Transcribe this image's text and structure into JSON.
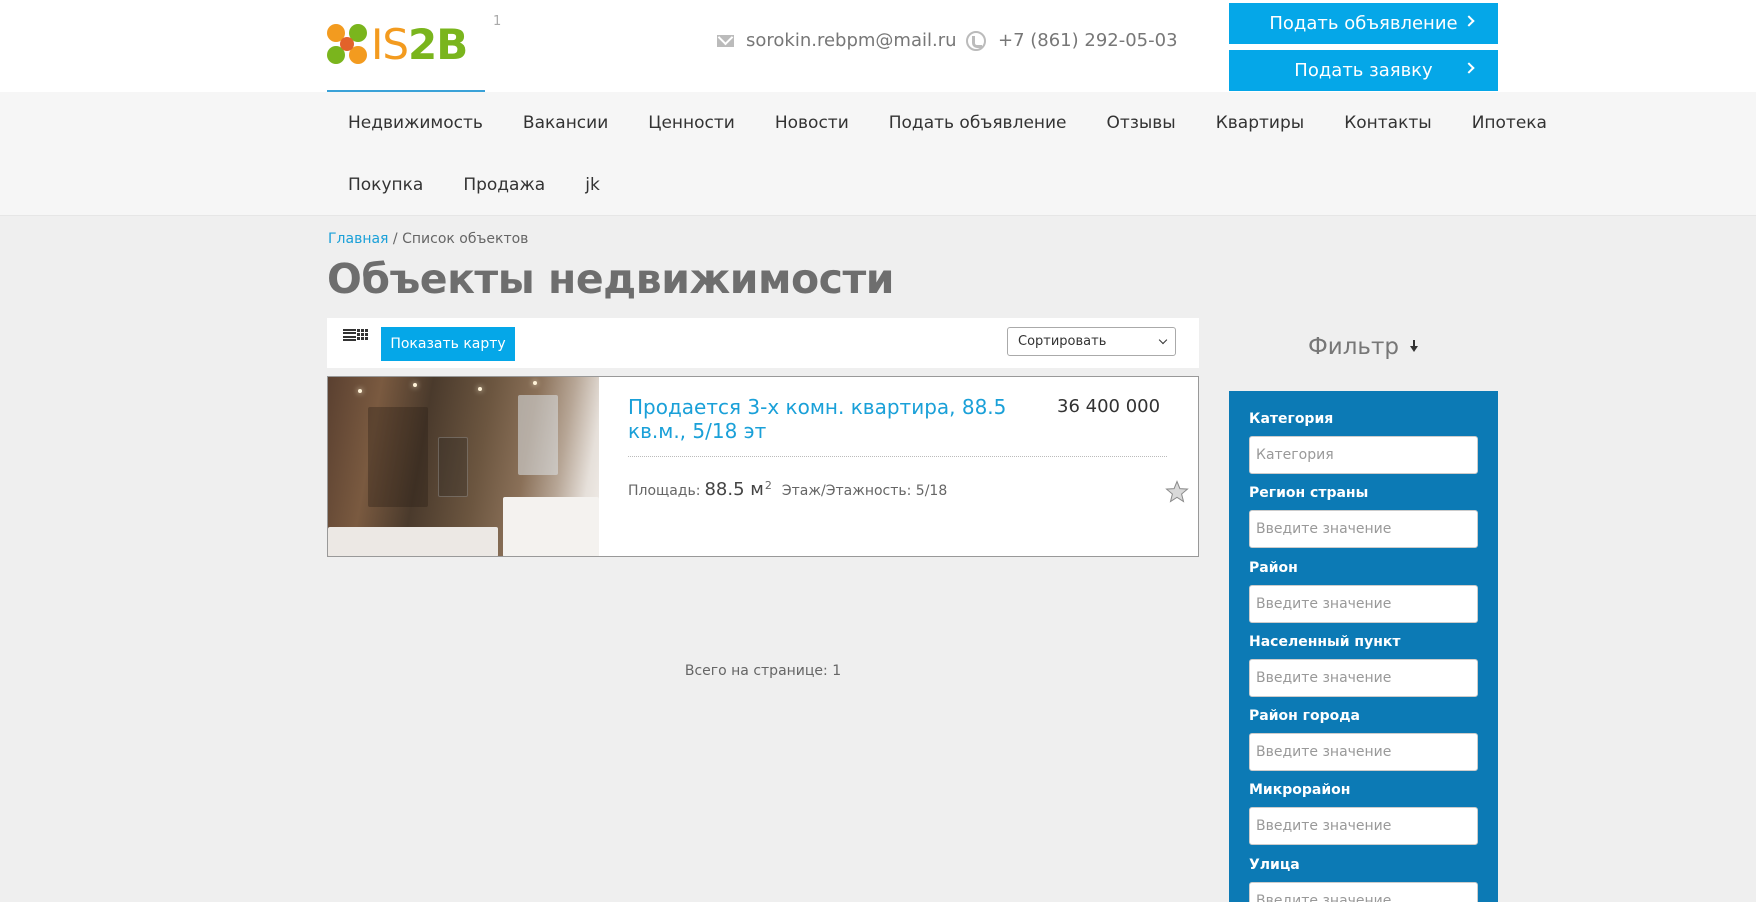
{
  "header": {
    "logo_text_is": "IS",
    "logo_text_2b": "2B",
    "logo_sup": "1",
    "email": "sorokin.rebpm@mail.ru",
    "phone": "+7 (861) 292-05-03",
    "btn_post_ad": "Подать объявление",
    "btn_request": "Подать заявку",
    "icons": {
      "email": "mail-icon",
      "phone": "phone-icon",
      "chevron": "chevron-right-icon"
    }
  },
  "nav": {
    "row1": [
      "Недвижимость",
      "Вакансии",
      "Ценности",
      "Новости",
      "Подать объявление",
      "Отзывы",
      "Квартиры",
      "Контакты",
      "Ипотека"
    ],
    "row2": [
      "Покупка",
      "Продажа",
      "jk"
    ]
  },
  "breadcrumb": {
    "home": "Главная",
    "separator": " / ",
    "current": "Список объектов"
  },
  "page_title": "Объекты недвижимости",
  "toolbar": {
    "show_map": "Показать карту",
    "sort_label": "Сортировать"
  },
  "listing": {
    "title": "Продается 3-х комн. квартира, 88.5 кв.м., 5/18 эт",
    "price": "36 400 000",
    "area_label": "Площадь:",
    "area_value": "88.5 м",
    "area_sup": "2",
    "floor": "Этаж/Этажность: 5/18"
  },
  "total": "Всего на странице: 1",
  "filter": {
    "title": "Фильтр",
    "fields": [
      {
        "label": "Категория",
        "placeholder": "Категория"
      },
      {
        "label": "Регион страны",
        "placeholder": "Введите значение"
      },
      {
        "label": "Район",
        "placeholder": "Введите значение"
      },
      {
        "label": "Населенный пункт",
        "placeholder": "Введите значение"
      },
      {
        "label": "Район города",
        "placeholder": "Введите значение"
      },
      {
        "label": "Микрорайон",
        "placeholder": "Введите значение"
      },
      {
        "label": "Улица",
        "placeholder": "Введите значение"
      }
    ]
  },
  "colors": {
    "accent": "#05a7e8",
    "link": "#1aa0d8",
    "filter_bg": "#0c7ab5",
    "page_bg": "#efefef"
  }
}
